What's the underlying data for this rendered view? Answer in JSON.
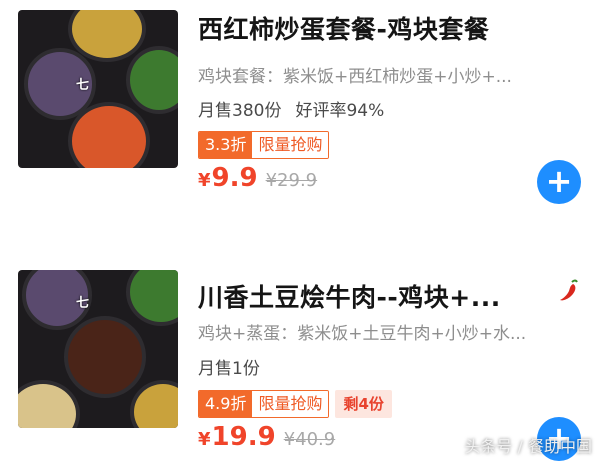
{
  "items": [
    {
      "title": "西红柿炒蛋套餐-鸡块套餐",
      "description": "鸡块套餐：紫米饭+西红柿炒蛋+小炒+...",
      "monthly_sales": "月售380份",
      "rating": "好评率94%",
      "discount": "3.3折",
      "flash_sale": "限量抢购",
      "stock_left": "",
      "currency": "¥",
      "price": "9.9",
      "original_price": "¥29.9",
      "add_icon": "plus-icon",
      "spicy_icon": ""
    },
    {
      "title": "川香土豆烩牛肉--鸡块+...",
      "description": "鸡块+蒸蛋：紫米饭+土豆牛肉+小炒+水...",
      "monthly_sales": "月售1份",
      "rating": "",
      "discount": "4.9折",
      "flash_sale": "限量抢购",
      "stock_left": "剩4份",
      "currency": "¥",
      "price": "19.9",
      "original_price": "¥40.9",
      "add_icon": "plus-icon",
      "spicy_icon": "chili-pepper-icon"
    }
  ],
  "watermark": "头条号 / 餐助中国",
  "colors": {
    "accent_orange": "#f26a2b",
    "price_red": "#f0442a",
    "add_button_blue": "#1e8eff"
  }
}
